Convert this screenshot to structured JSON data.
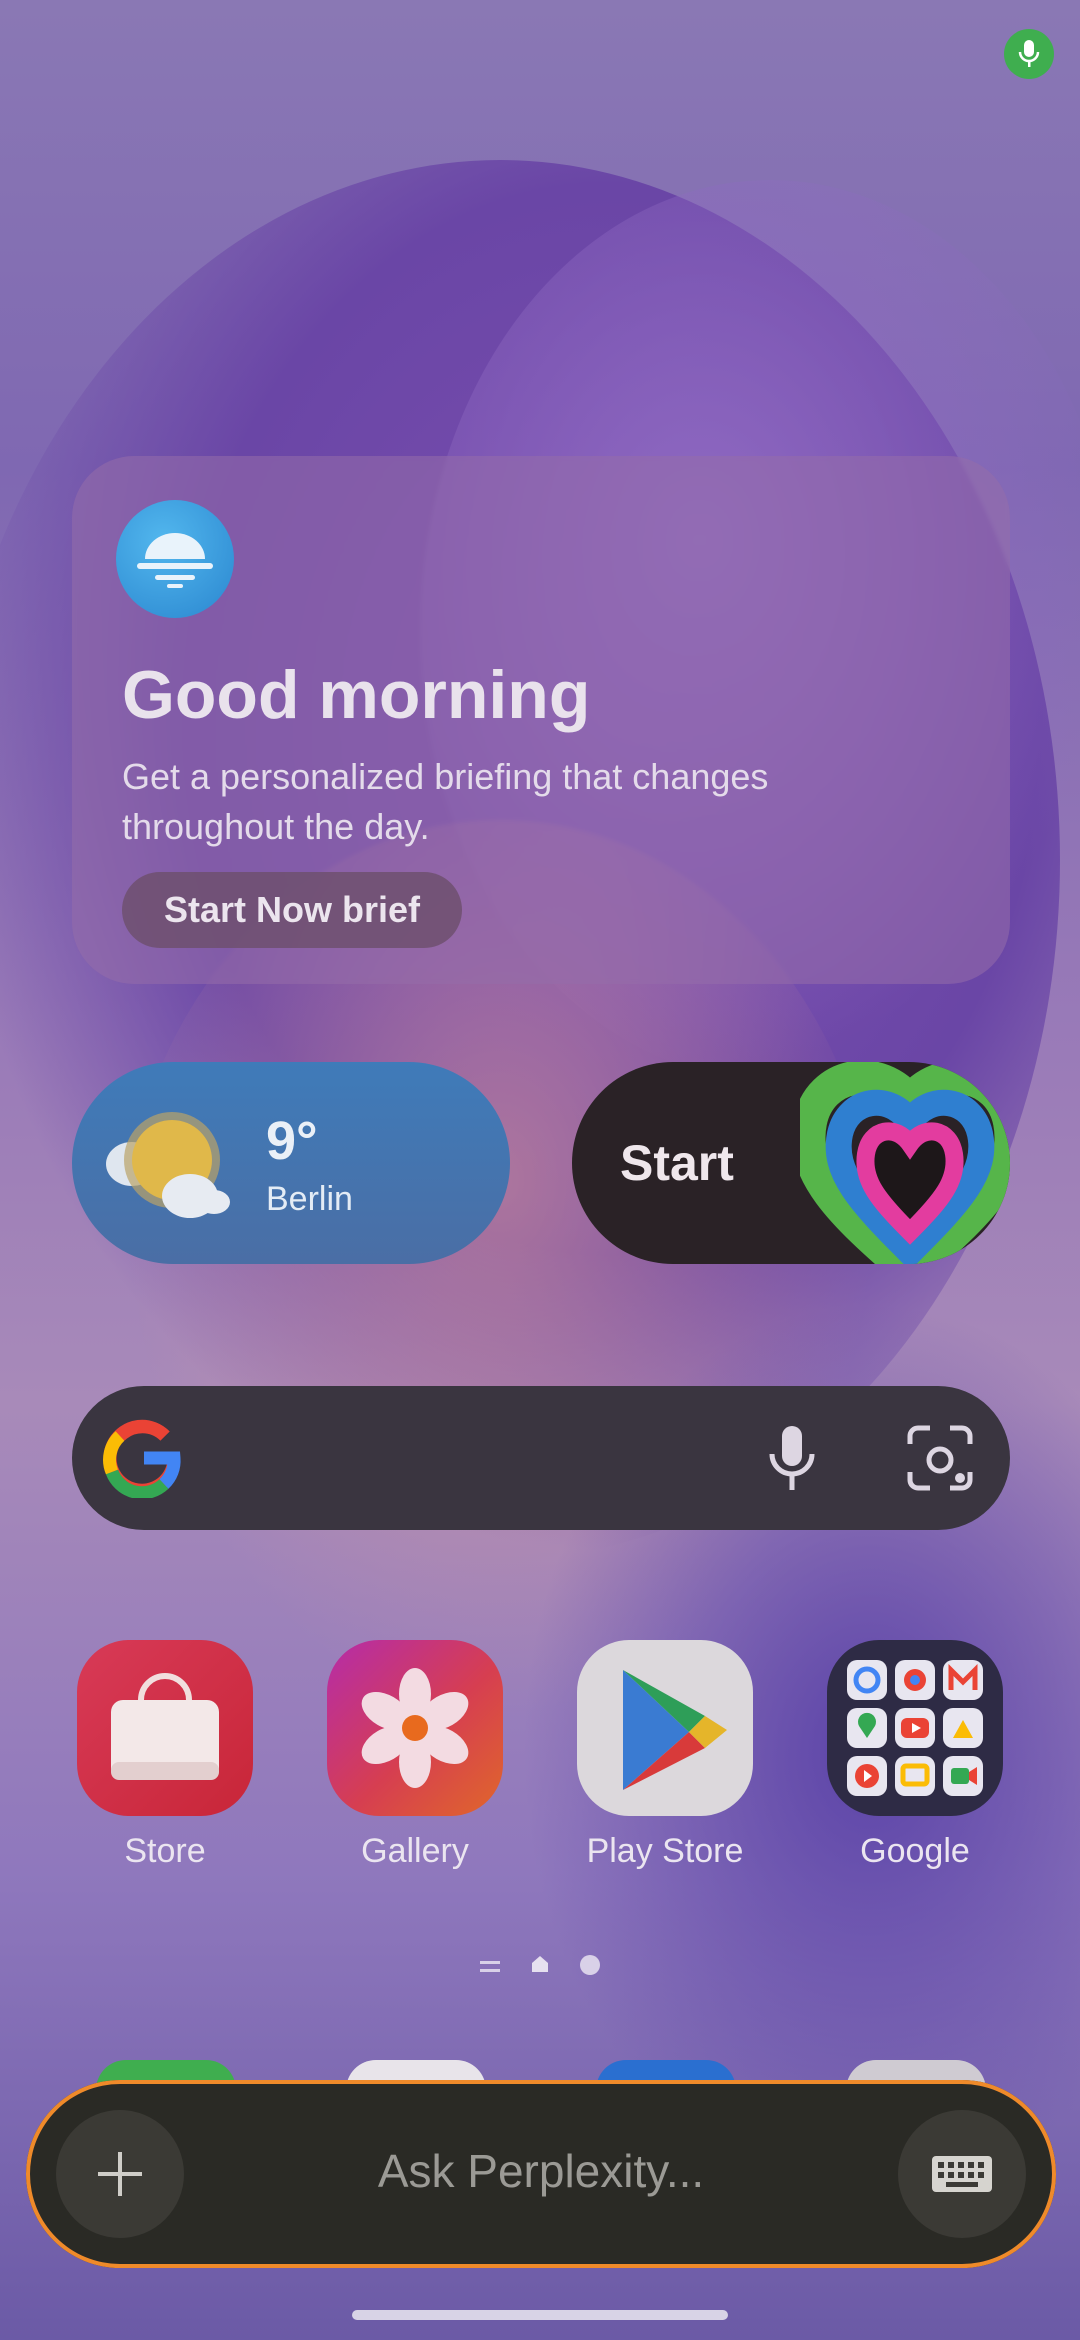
{
  "status": {
    "mic_indicator_icon": "mic-icon",
    "mic_color": "#3fae4f"
  },
  "brief": {
    "icon": "sunrise-icon",
    "title": "Good morning",
    "subtitle": "Get a personalized briefing that changes throughout the day.",
    "button_label": "Start Now brief"
  },
  "weather": {
    "icon": "partly-sunny-icon",
    "temperature": "9°",
    "city": "Berlin"
  },
  "start_widget": {
    "label": "Start",
    "art": "heart-rings-icon"
  },
  "search": {
    "logo": "google-g-icon",
    "mic": "mic-icon",
    "lens": "lens-icon"
  },
  "apps": [
    {
      "label": "Store",
      "icon": "shopping-bag-icon"
    },
    {
      "label": "Gallery",
      "icon": "flower-icon"
    },
    {
      "label": "Play Store",
      "icon": "play-store-icon"
    },
    {
      "label": "Google",
      "icon": "google-folder-icon"
    }
  ],
  "pager": {
    "current": "home"
  },
  "ask": {
    "placeholder": "Ask Perplexity...",
    "plus": "plus-icon",
    "keyboard": "keyboard-icon",
    "accent": "#ef8a2a"
  }
}
